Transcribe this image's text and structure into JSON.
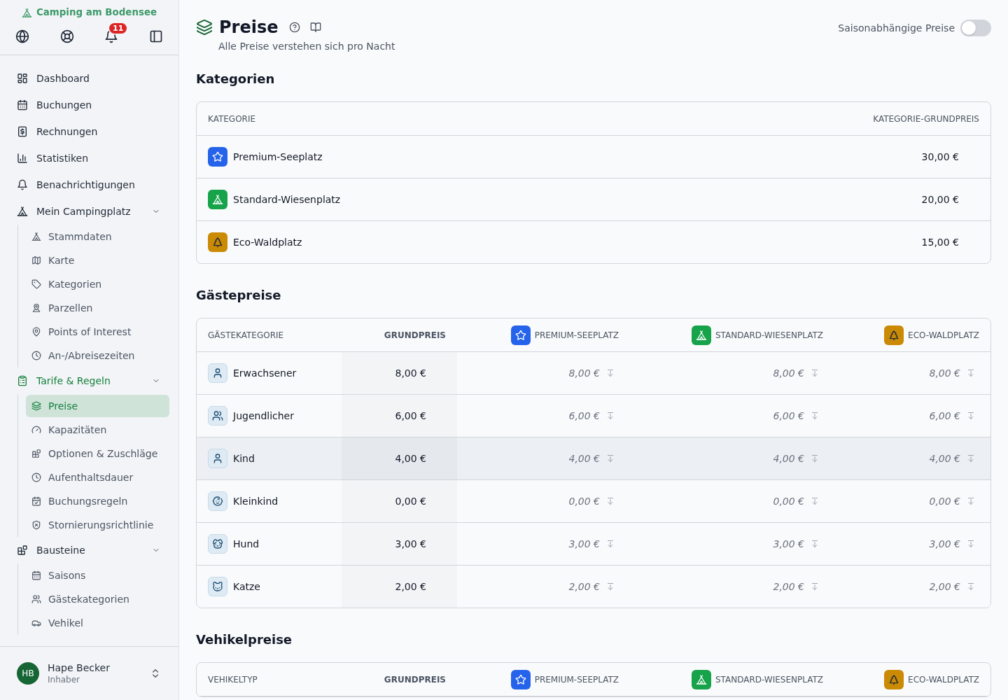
{
  "sidebar": {
    "brand": "Camping am Bodensee",
    "notification_count": "11",
    "nav": [
      {
        "label": "Dashboard",
        "selected": false
      },
      {
        "label": "Buchungen",
        "selected": false
      },
      {
        "label": "Rechnungen",
        "selected": false
      },
      {
        "label": "Statistiken",
        "selected": false
      },
      {
        "label": "Benachrichtigungen",
        "selected": false
      },
      {
        "label": "Mein Campingplatz",
        "selected": false,
        "expanded": true,
        "children": [
          {
            "label": "Stammdaten",
            "selected": false
          },
          {
            "label": "Karte",
            "selected": false
          },
          {
            "label": "Kategorien",
            "selected": false
          },
          {
            "label": "Parzellen",
            "selected": false
          },
          {
            "label": "Points of Interest",
            "selected": false
          },
          {
            "label": "An-/Abreisezeiten",
            "selected": false
          }
        ]
      },
      {
        "label": "Tarife & Regeln",
        "selected": false,
        "expanded": true,
        "children": [
          {
            "label": "Preise",
            "selected": true
          },
          {
            "label": "Kapazitäten",
            "selected": false
          },
          {
            "label": "Optionen & Zuschläge",
            "selected": false
          },
          {
            "label": "Aufenthaltsdauer",
            "selected": false
          },
          {
            "label": "Buchungsregeln",
            "selected": false
          },
          {
            "label": "Stornierungsrichtlinie",
            "selected": false
          }
        ]
      },
      {
        "label": "Bausteine",
        "selected": false,
        "expanded": true,
        "children": [
          {
            "label": "Saisons",
            "selected": false
          },
          {
            "label": "Gästekategorien",
            "selected": false
          },
          {
            "label": "Vehikel",
            "selected": false
          }
        ]
      }
    ],
    "user": {
      "initials": "HB",
      "name": "Hape Becker",
      "role": "Inhaber"
    }
  },
  "page": {
    "title": "Preise",
    "subtitle": "Alle Preise verstehen sich pro Nacht",
    "seasonal_toggle": {
      "label": "Saisonabhängige Preise",
      "on": false
    }
  },
  "categories": {
    "title": "Kategorien",
    "columns": [
      "KATEGORIE",
      "KATEGORIE-GRUNDPREIS"
    ],
    "rows": [
      {
        "name": "Premium-Seeplatz",
        "price": "30,00 €",
        "color": "#2563eb"
      },
      {
        "name": "Standard-Wiesenplatz",
        "price": "20,00 €",
        "color": "#16a34a"
      },
      {
        "name": "Eco-Waldplatz",
        "price": "15,00 €",
        "color": "#ca8a04"
      }
    ]
  },
  "guest_prices": {
    "title": "Gästepreise",
    "label_column": "GÄSTEKATEGORIE",
    "base_column": "GRUNDPREIS",
    "category_columns": [
      {
        "label": "PREMIUM-SEEPLATZ",
        "color": "#2563eb"
      },
      {
        "label": "STANDARD-WIESENPLATZ",
        "color": "#16a34a"
      },
      {
        "label": "ECO-WALDPLATZ",
        "color": "#ca8a04"
      }
    ],
    "rows": [
      {
        "name": "Erwachsener",
        "base": "8,00 €",
        "hovered": false,
        "prices": [
          {
            "value": "8,00 €",
            "inherited": true
          },
          {
            "value": "8,00 €",
            "inherited": true
          },
          {
            "value": "8,00 €",
            "inherited": true
          }
        ]
      },
      {
        "name": "Jugendlicher",
        "base": "6,00 €",
        "hovered": false,
        "prices": [
          {
            "value": "6,00 €",
            "inherited": true
          },
          {
            "value": "6,00 €",
            "inherited": true
          },
          {
            "value": "6,00 €",
            "inherited": true
          }
        ]
      },
      {
        "name": "Kind",
        "base": "4,00 €",
        "hovered": true,
        "prices": [
          {
            "value": "4,00 €",
            "inherited": true
          },
          {
            "value": "4,00 €",
            "inherited": true
          },
          {
            "value": "4,00 €",
            "inherited": true
          }
        ]
      },
      {
        "name": "Kleinkind",
        "base": "0,00 €",
        "hovered": false,
        "prices": [
          {
            "value": "0,00 €",
            "inherited": true
          },
          {
            "value": "0,00 €",
            "inherited": true
          },
          {
            "value": "0,00 €",
            "inherited": true
          }
        ]
      },
      {
        "name": "Hund",
        "base": "3,00 €",
        "hovered": false,
        "prices": [
          {
            "value": "3,00 €",
            "inherited": true
          },
          {
            "value": "3,00 €",
            "inherited": true
          },
          {
            "value": "3,00 €",
            "inherited": true
          }
        ]
      },
      {
        "name": "Katze",
        "base": "2,00 €",
        "hovered": false,
        "prices": [
          {
            "value": "2,00 €",
            "inherited": true
          },
          {
            "value": "2,00 €",
            "inherited": true
          },
          {
            "value": "2,00 €",
            "inherited": true
          }
        ]
      }
    ]
  },
  "vehicle_prices": {
    "title": "Vehikelpreise",
    "label_column": "VEHIKELTYP",
    "base_column": "GRUNDPREIS",
    "category_columns": [
      {
        "label": "PREMIUM-SEEPLATZ",
        "color": "#2563eb"
      },
      {
        "label": "STANDARD-WIESENPLATZ",
        "color": "#16a34a"
      },
      {
        "label": "ECO-WALDPLATZ",
        "color": "#ca8a04"
      }
    ]
  }
}
